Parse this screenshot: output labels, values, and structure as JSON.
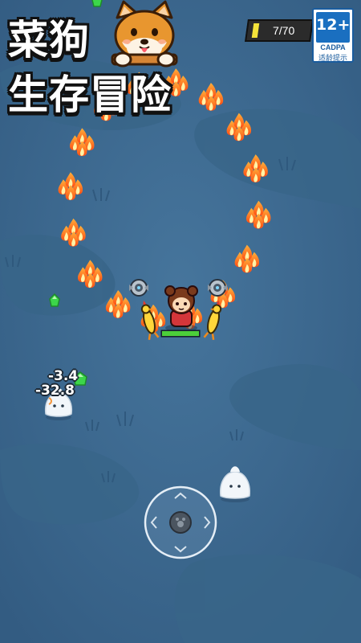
{
  "title": {
    "line1": "菜狗",
    "line2": "生存冒险"
  },
  "hud": {
    "xp_text": "7/70",
    "xp_progress": 0.1,
    "xp_color": "#f4e33a",
    "player_health": 1.0,
    "health_color": "#4ccf3a"
  },
  "age_rating": {
    "label": "12+",
    "org": "CADPA",
    "note": "适龄提示"
  },
  "damage_numbers": [
    "-3.4",
    "-32.8"
  ],
  "colors": {
    "ground": "#3f6d94",
    "fire": "#ff6a1a",
    "gem": "#3cd64a",
    "ghost": "#f2f6fa"
  },
  "icons": {
    "mascot": "shiba-dog-icon",
    "player": "player-character-icon",
    "drone": "orbiting-drone-icon",
    "weapon": "rubber-chicken-icon",
    "fire": "fireball-icon",
    "gem": "xp-gem-icon",
    "enemy": "ghost-enemy-icon",
    "joystick": "virtual-joystick-icon"
  }
}
